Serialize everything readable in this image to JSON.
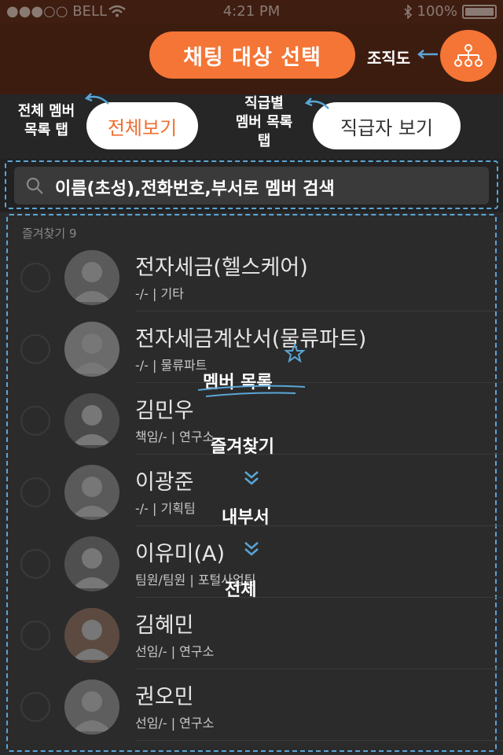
{
  "status_bar": {
    "carrier": "●●●○○ BELL",
    "time": "4:21 PM",
    "battery": "100%",
    "battery_level": 1.0
  },
  "header": {
    "title": "채팅 대상 선택",
    "org_label": "조직도"
  },
  "tabs": {
    "all_label": "전체보기",
    "rank_label": "직급자 보기",
    "all_note": "전체 멤버\n목록 탭",
    "rank_note": "직급별\n멤버 목록\n탭"
  },
  "search": {
    "placeholder": "이름(초성),전화번호,부서로 멤버 검색",
    "annotation": "이름(초성),전화번호,부서로 멤버 검색"
  },
  "list": {
    "section_header": "즐겨찾기 9",
    "members": [
      {
        "name": "전자세금(헬스케어)",
        "sub": "-/- | 기타"
      },
      {
        "name": "전자세금계산서(물류파트)",
        "sub": "-/- | 물류파트"
      },
      {
        "name": "김민우",
        "sub": "책임/- | 연구소"
      },
      {
        "name": "이광준",
        "sub": "-/- | 기획팀"
      },
      {
        "name": "이유미(A)",
        "sub": "팀원/팀원 | 포털사업팀"
      },
      {
        "name": "김혜민",
        "sub": "선임/- | 연구소"
      },
      {
        "name": "권오민",
        "sub": "선임/- | 연구소"
      }
    ]
  },
  "annotations": {
    "member_list": "멤버 목록",
    "order_1": "즐겨찾기",
    "order_2": "내부서",
    "order_3": "전체"
  },
  "colors": {
    "accent": "#f47535",
    "header_bg": "#3d1c10",
    "note_blue": "#5aa5d6"
  },
  "icons": [
    "wifi-icon",
    "bluetooth-icon",
    "battery-icon",
    "org-chart-icon",
    "search-icon",
    "avatar-icon",
    "arrow-icon",
    "star-icon",
    "chevron-down-icon"
  ]
}
